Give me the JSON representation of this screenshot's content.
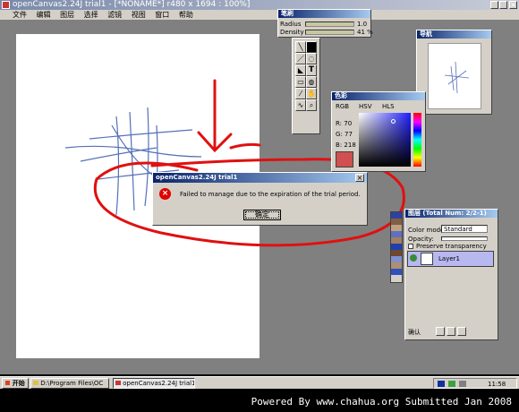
{
  "app": {
    "title": "openCanvas2.24J trial1 - [*NONAME*] r480 x 1694 : 100%]",
    "menu": [
      "文件",
      "编辑",
      "图层",
      "选择",
      "滤镜",
      "视图",
      "窗口",
      "帮助"
    ]
  },
  "brush_panel": {
    "title": "笔刷",
    "rows": [
      {
        "label": "Radius",
        "value": "1.0"
      },
      {
        "label": "Density",
        "value": "41 %"
      }
    ]
  },
  "tools_panel": {
    "tools": [
      "pen-tool-icon",
      "rect-select-icon",
      "line-tool-icon",
      "lasso-tool-icon",
      "fill-tool-icon",
      "text-tool-icon",
      "eraser-tool-icon",
      "blur-tool-icon",
      "dropper-tool-icon",
      "hand-tool-icon",
      "curve-tool-icon",
      "zoom-tool-icon"
    ]
  },
  "color_panel": {
    "title": "色彩",
    "tabs": [
      "RGB",
      "HSV",
      "HLS"
    ],
    "rgb": [
      {
        "label": "R",
        "value": "70"
      },
      {
        "label": "G",
        "value": "77"
      },
      {
        "label": "B",
        "value": "218"
      }
    ],
    "current_color": "#464dda"
  },
  "navigator": {
    "title": "导航"
  },
  "layer_panel": {
    "title": "图层 (Total Num: 2/2-1)",
    "mode_label": "Color mode:",
    "mode_value": "Standard",
    "opacity_label": "Opacity:",
    "preserve_label": "Preserve transparency",
    "layer_name": "Layer1",
    "footer": "确认"
  },
  "dialog": {
    "title": "openCanvas2.24J trial1",
    "message": "Failed to manage due to the expiration of the trial period.",
    "ok_label": "确定"
  },
  "taskbar": {
    "start_label": "开始",
    "tasks": [
      "D:\\Program Files\\OC",
      "openCanvas2.24J trial1"
    ],
    "clock": "11:58"
  },
  "watermark": {
    "text": "Powered By www.chahua.org   Submitted Jan 2008"
  }
}
